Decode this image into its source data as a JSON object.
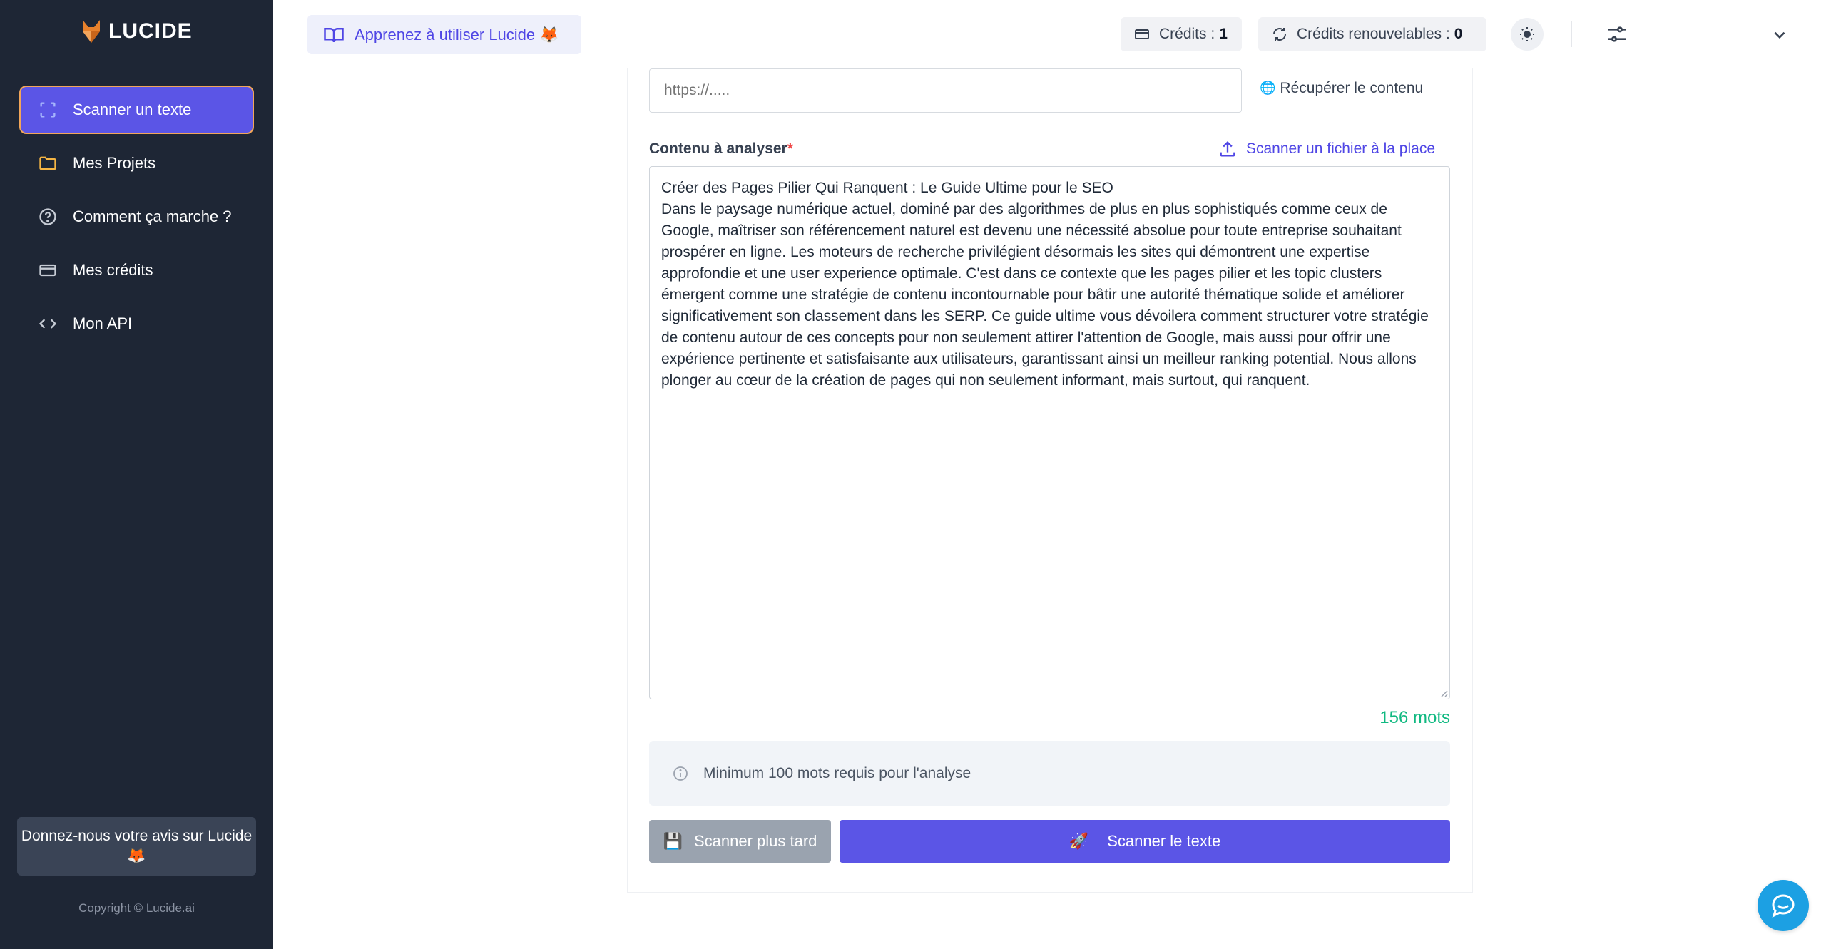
{
  "sidebar": {
    "logo_text": "LUCIDE",
    "items": [
      {
        "label": "Scanner un texte",
        "icon": "scan-icon",
        "active": true
      },
      {
        "label": "Mes Projets",
        "icon": "folder-icon"
      },
      {
        "label": "Comment ça marche ?",
        "icon": "help-circle-icon"
      },
      {
        "label": "Mes crédits",
        "icon": "credit-card-icon"
      },
      {
        "label": "Mon API",
        "icon": "code-icon"
      }
    ],
    "feedback_label": "Donnez-nous votre avis sur Lucide 🦊",
    "copyright": "Copyright © Lucide.ai"
  },
  "header": {
    "learn_label": "Apprenez à utiliser Lucide 🦊",
    "credits_label": "Crédits :",
    "credits_value": "1",
    "renewable_label": "Crédits renouvelables :",
    "renewable_value": "0"
  },
  "form": {
    "url_placeholder": "https://.....",
    "fetch_label": "Récupérer le contenu",
    "content_label": "Contenu à analyser",
    "required_mark": "*",
    "upload_label": "Scanner un fichier à la place",
    "content_text": "Créer des Pages Pilier Qui Ranquent : Le Guide Ultime pour le SEO\nDans le paysage numérique actuel, dominé par des algorithmes de plus en plus sophistiqués comme ceux de Google, maîtriser son référencement naturel est devenu une nécessité absolue pour toute entreprise souhaitant prospérer en ligne. Les moteurs de recherche privilégient désormais les sites qui démontrent une expertise approfondie et une user experience optimale. C'est dans ce contexte que les pages pilier et les topic clusters émergent comme une stratégie de contenu incontournable pour bâtir une autorité thématique solide et améliorer significativement son classement dans les SERP. Ce guide ultime vous dévoilera comment structurer votre stratégie de contenu autour de ces concepts pour non seulement attirer l'attention de Google, mais aussi pour offrir une expérience pertinente et satisfaisante aux utilisateurs, garantissant ainsi un meilleur ranking potential. Nous allons plonger au cœur de la création de pages qui non seulement informant, mais surtout, qui ranquent.",
    "word_count": "156 mots",
    "info_text": "Minimum 100 mots requis pour l'analyse",
    "later_label": "Scanner plus tard",
    "later_emoji": "💾",
    "scan_label": "Scanner le texte",
    "scan_emoji": "🚀"
  },
  "colors": {
    "sidebar_bg": "#1e2635",
    "accent": "#5b55e6",
    "success": "#10b981"
  }
}
